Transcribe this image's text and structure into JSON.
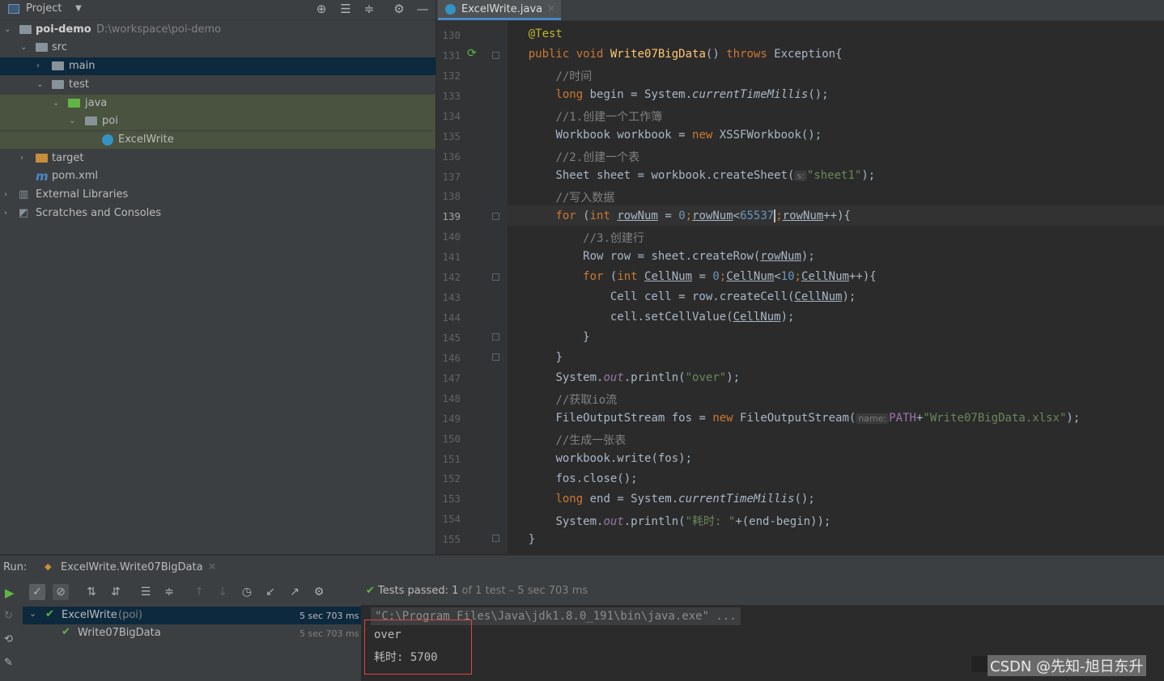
{
  "project_panel": {
    "title": "Project",
    "tree": [
      {
        "label": "poi-demo",
        "path": "D:\\workspace\\poi-demo"
      },
      {
        "label": "src"
      },
      {
        "label": "main"
      },
      {
        "label": "test"
      },
      {
        "label": "java"
      },
      {
        "label": "poi"
      },
      {
        "label": "ExcelWrite"
      },
      {
        "label": "target"
      },
      {
        "label": "pom.xml"
      },
      {
        "label": "External Libraries"
      },
      {
        "label": "Scratches and Consoles"
      }
    ]
  },
  "editor": {
    "tab_label": "ExcelWrite.java",
    "current_line": "139",
    "line_numbers": [
      "130",
      "131",
      "132",
      "133",
      "134",
      "135",
      "136",
      "137",
      "138",
      "139",
      "140",
      "141",
      "142",
      "143",
      "144",
      "145",
      "146",
      "147",
      "148",
      "149",
      "150",
      "151",
      "152",
      "153",
      "154",
      "155"
    ],
    "code": {
      "l130_ann": "@Test",
      "l131_kw1": "public void ",
      "l131_fn": "Write07BigData",
      "l131_mid": "() ",
      "l131_kw2": "throws ",
      "l131_end": "Exception{",
      "l132_cm": "//时间",
      "l133_kw": "long ",
      "l133_a": "begin = System.",
      "l133_it": "currentTimeMillis",
      "l133_b": "();",
      "l134_cm": "//1.创建一个工作簿",
      "l135_a": "Workbook workbook = ",
      "l135_kw": "new ",
      "l135_b": "XSSFWorkbook();",
      "l136_cm": "//2.创建一个表",
      "l137_a": "Sheet sheet = workbook.createSheet(",
      "l137_hint": "s:",
      "l137_str": "\"sheet1\"",
      "l137_b": ");",
      "l138_cm": "//写入数据",
      "l139_kw": "for ",
      "l139_a": "(",
      "l139_kw2": "int ",
      "l139_v1": "rowNum",
      "l139_b": " = ",
      "l139_n1": "0",
      "l139_c": ";",
      "l139_v2": "rowNum",
      "l139_d": "<",
      "l139_n2": "65537",
      "l139_e": ";",
      "l139_v3": "rowNum",
      "l139_f": "++){",
      "l140_cm": "//3.创建行",
      "l141_a": "Row row = sheet.createRow(",
      "l141_v": "rowNum",
      "l141_b": ");",
      "l142_kw": "for ",
      "l142_a": "(",
      "l142_kw2": "int ",
      "l142_v1": "CellNum",
      "l142_b": " = ",
      "l142_n1": "0",
      "l142_c": ";",
      "l142_v2": "CellNum",
      "l142_d": "<",
      "l142_n2": "10",
      "l142_e": ";",
      "l142_v3": "CellNum",
      "l142_f": "++){",
      "l143_a": "Cell cell = row.createCell(",
      "l143_v": "CellNum",
      "l143_b": ");",
      "l144_a": "cell.setCellValue(",
      "l144_v": "CellNum",
      "l144_b": ");",
      "l145": "}",
      "l146": "}",
      "l147_a": "System.",
      "l147_f": "out",
      "l147_b": ".println(",
      "l147_str": "\"over\"",
      "l147_c": ");",
      "l148_cm": "//获取io流",
      "l149_a": "FileOutputStream fos = ",
      "l149_kw": "new ",
      "l149_b": "FileOutputStream(",
      "l149_hint": "name:",
      "l149_f": "PATH",
      "l149_c": "+",
      "l149_str": "\"Write07BigData.xlsx\"",
      "l149_d": ");",
      "l150_cm": "//生成一张表",
      "l151": "workbook.write(fos);",
      "l152": "fos.close();",
      "l153_kw": "long ",
      "l153_a": "end = System.",
      "l153_it": "currentTimeMillis",
      "l153_b": "();",
      "l154_a": "System.",
      "l154_f": "out",
      "l154_b": ".println(",
      "l154_str": "\"耗时: \"",
      "l154_c": "+(end-begin));",
      "l155": "}"
    }
  },
  "run_panel": {
    "run_label": "Run:",
    "run_tab": "ExcelWrite.Write07BigData",
    "status_bold": "Tests passed: ",
    "status_count": "1",
    "status_rest": " of 1 test – 5 sec 703 ms",
    "tests": [
      {
        "label": "ExcelWrite",
        "pkg": " (poi)",
        "time": "5 sec 703 ms"
      },
      {
        "label": "Write07BigData",
        "time": "5 sec 703 ms"
      }
    ],
    "console": {
      "cmd": "\"C:\\Program Files\\Java\\jdk1.8.0_191\\bin\\java.exe\" ...",
      "out1": "over",
      "out2": "耗时: 5700"
    }
  },
  "watermark": "CSDN @先知-旭日东升",
  "colors": {
    "selection": "#0d293e",
    "test_highlight": "#49533f",
    "pass_green": "#62b543",
    "annotation_box": "#e04343"
  }
}
